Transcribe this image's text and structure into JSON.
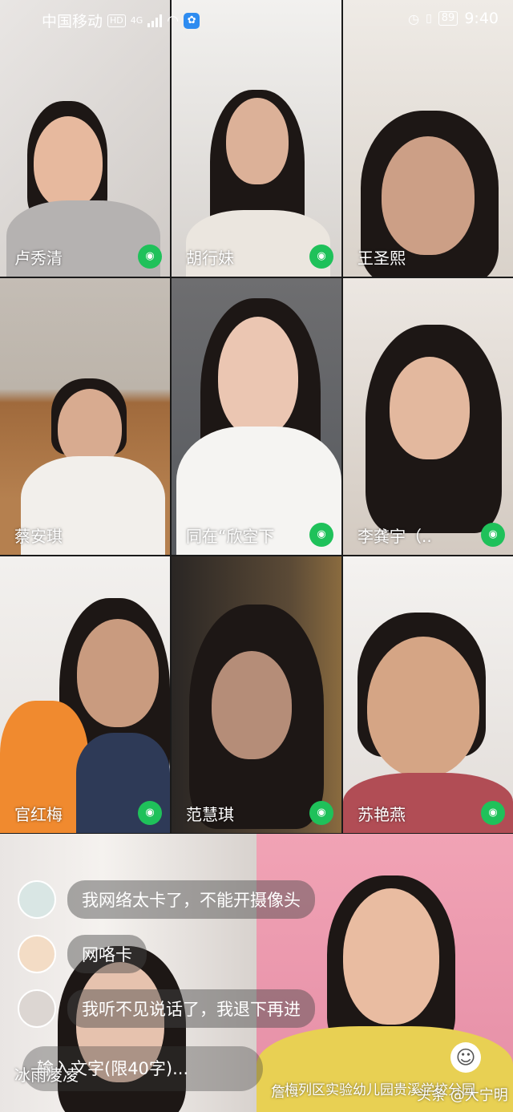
{
  "status_bar": {
    "carrier": "中国移动",
    "hd": "HD",
    "net": "4G",
    "battery": "89",
    "time": "9:40"
  },
  "participants": [
    {
      "name": "卢秀清",
      "mic": true
    },
    {
      "name": "胡行妹",
      "mic": true
    },
    {
      "name": "王圣熙",
      "mic": false
    },
    {
      "name": "蔡安琪",
      "mic": false
    },
    {
      "name": "同在“欣空下",
      "mic": true
    },
    {
      "name": "李龚宇（..",
      "mic": true
    },
    {
      "name": "官红梅",
      "mic": true
    },
    {
      "name": "范慧琪",
      "mic": true
    },
    {
      "name": "苏艳燕",
      "mic": true
    }
  ],
  "bottom": {
    "left_name": "冰雨凌凌",
    "right_name": "詹...",
    "chat": [
      {
        "text": "我网络太卡了，不能开摄像头"
      },
      {
        "text": "网咯卡"
      },
      {
        "text": "我听不见说话了，我退下再进"
      }
    ],
    "input_placeholder": "输入文字(限40字)...",
    "watermark_school": "梅列区实验幼儿园贵溪学校分园",
    "watermark_source": "头条 @大宁明"
  },
  "colors": {
    "mic_green": "#1fc15a"
  }
}
